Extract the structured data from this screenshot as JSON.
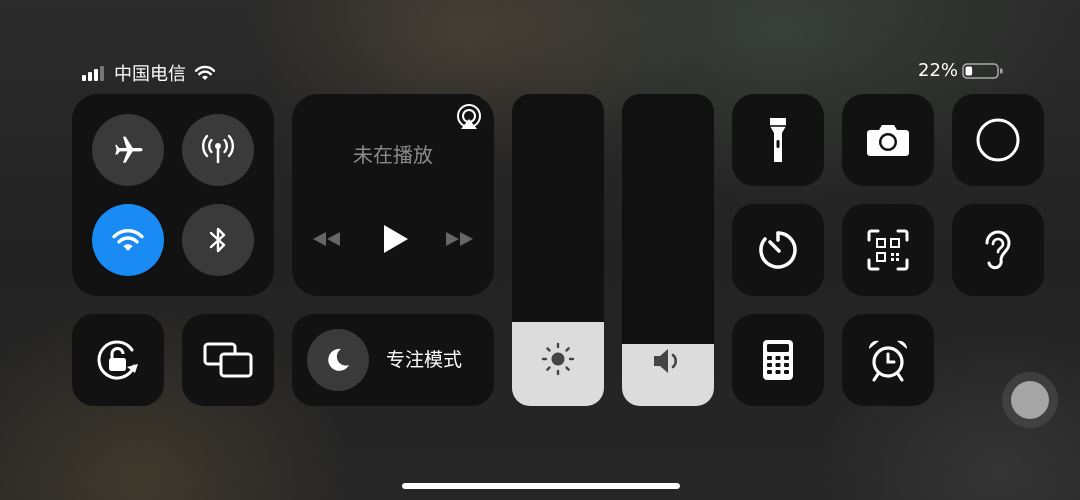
{
  "status_bar": {
    "carrier": "中国电信",
    "battery_percent_text": "22%",
    "battery_level": 0.22
  },
  "connectivity": {
    "airplane_mode": false,
    "cellular_data": false,
    "wifi": true,
    "bluetooth": false
  },
  "now_playing": {
    "title": "未在播放"
  },
  "focus": {
    "label": "专注模式"
  },
  "sliders": {
    "brightness_level": 0.27,
    "volume_level": 0.2
  },
  "colors": {
    "accent_blue": "#1a8bf5",
    "tile_bg": "#121212",
    "slider_fill": "#dcdcdc"
  },
  "controls": {
    "row1": [
      "flashlight-icon",
      "camera-icon",
      "screen-record-icon"
    ],
    "row2": [
      "timer-icon",
      "qr-scanner-icon",
      "hearing-icon"
    ],
    "row3": [
      "calculator-icon",
      "alarm-icon"
    ]
  }
}
